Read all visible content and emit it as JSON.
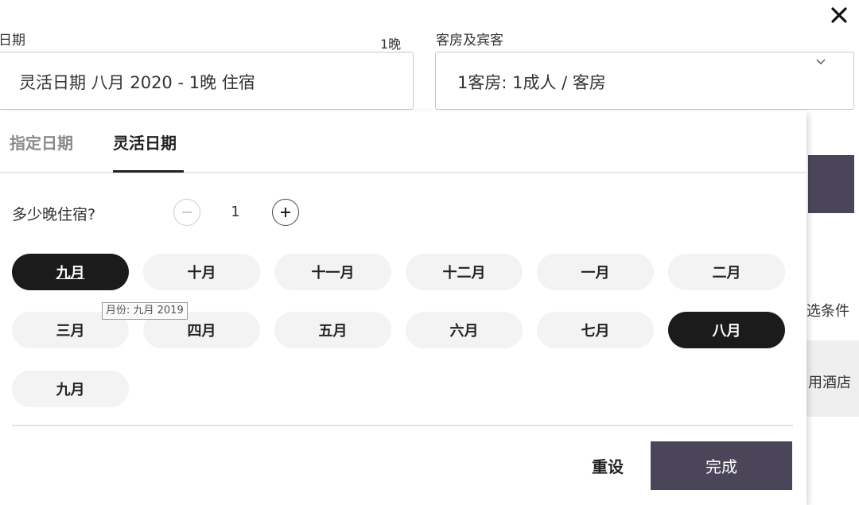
{
  "header": {
    "date_label": "日期",
    "nights_label": "1晚",
    "date_value": "灵活日期 八月 2020 - 1晚 住宿",
    "rooms_label": "客房及宾客",
    "rooms_value": "1客房: 1成人 / 客房"
  },
  "tabs": [
    {
      "label": "指定日期",
      "active": false
    },
    {
      "label": "灵活日期",
      "active": true
    }
  ],
  "nights": {
    "question": "多少晚住宿?",
    "value": "1"
  },
  "months": [
    {
      "label": "九月",
      "selected": true
    },
    {
      "label": "十月",
      "selected": false
    },
    {
      "label": "十一月",
      "selected": false
    },
    {
      "label": "十二月",
      "selected": false
    },
    {
      "label": "一月",
      "selected": false
    },
    {
      "label": "二月",
      "selected": false
    },
    {
      "label": "三月",
      "selected": false
    },
    {
      "label": "四月",
      "selected": false
    },
    {
      "label": "五月",
      "selected": false
    },
    {
      "label": "六月",
      "selected": false
    },
    {
      "label": "七月",
      "selected": false
    },
    {
      "label": "八月",
      "selected": true
    },
    {
      "label": "九月",
      "selected": false
    }
  ],
  "tooltip": "月份: 九月 2019",
  "actions": {
    "reset_label": "重设",
    "done_label": "完成"
  },
  "background": {
    "filter_text": "选条件",
    "hotel_text": "用酒店"
  },
  "colors": {
    "accent": "#4a4558",
    "selected_pill": "#1b1b1b",
    "pill": "#f3f3f3"
  },
  "icons": {
    "close": "close-icon",
    "chevron": "chevron-down-icon",
    "minus": "minus-icon",
    "plus": "plus-icon"
  }
}
